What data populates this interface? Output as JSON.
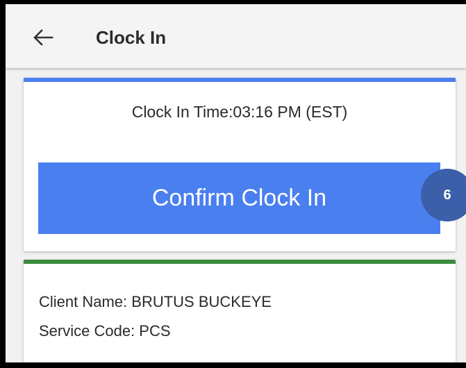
{
  "header": {
    "back_icon": "arrow-left-icon",
    "title": "Clock In"
  },
  "clock_card": {
    "accent_color": "#4a7ff0",
    "clock_in_time_text": "Clock In Time:03:16 PM (EST)",
    "confirm_button_label": "Confirm Clock In"
  },
  "step_badge": {
    "number": "6",
    "color": "#3b5fa8"
  },
  "client_card": {
    "accent_color": "#3d8b3d",
    "client_name_text": "Client Name: BRUTUS BUCKEYE",
    "service_code_text": "Service Code: PCS"
  }
}
